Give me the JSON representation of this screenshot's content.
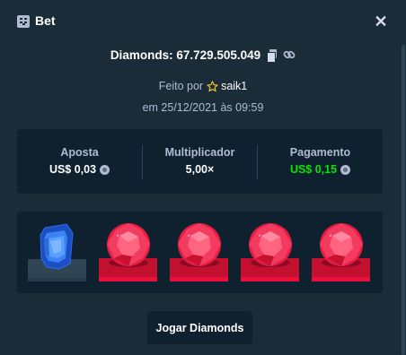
{
  "header": {
    "title": "Bet",
    "icon": "bet-slip-icon",
    "close_icon": "close-icon",
    "close_glyph": "✕"
  },
  "game": {
    "title": "Diamonds: 67.729.505.049",
    "copy_icon": "copy-icon",
    "link_icon": "link-icon"
  },
  "meta": {
    "made_by_prefix": "Feito por",
    "user": "saik1",
    "date": "em 25/12/2021 às 09:59"
  },
  "stats": [
    {
      "label": "Aposta",
      "value": "US$ 0,03",
      "currency_icon": "litecoin-icon"
    },
    {
      "label": "Multiplicador",
      "value": "5,00×"
    },
    {
      "label": "Pagamento",
      "value": "US$ 0,15",
      "currency_icon": "litecoin-icon",
      "color": "#00e701"
    }
  ],
  "gems": [
    {
      "kind": "blue-gem",
      "state": "unmatched"
    },
    {
      "kind": "red-gem",
      "state": "matched"
    },
    {
      "kind": "red-gem",
      "state": "matched"
    },
    {
      "kind": "red-gem",
      "state": "matched"
    },
    {
      "kind": "red-gem",
      "state": "matched"
    }
  ],
  "play_button": {
    "label": "Jogar Diamonds"
  },
  "colors": {
    "background": "#1a2c38",
    "panel": "#0f212e",
    "muted": "#b1bad3",
    "win": "#00e701",
    "red_base": "#e9113c",
    "gray_base": "#2f4553"
  }
}
